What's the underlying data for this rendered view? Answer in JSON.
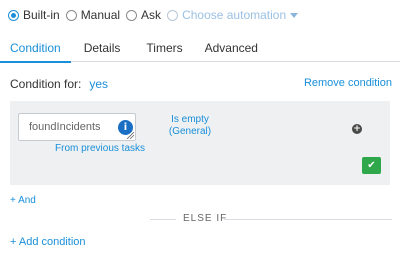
{
  "automation_mode": {
    "options": [
      {
        "label": "Built-in",
        "checked": true
      },
      {
        "label": "Manual",
        "checked": false
      },
      {
        "label": "Ask",
        "checked": false
      }
    ],
    "choose_automation": "Choose automation"
  },
  "tabs": [
    "Condition",
    "Details",
    "Timers",
    "Advanced"
  ],
  "active_tab": "Condition",
  "condition": {
    "label": "Condition for:",
    "value": "yes",
    "remove_label": "Remove condition",
    "field_value": "foundIncidents",
    "info_icon": "info-icon",
    "source_label": "From previous tasks",
    "operator_line1": "Is empty",
    "operator_line2": "(General)",
    "plus_icon": "plus-circle-icon",
    "check_icon": "check-icon"
  },
  "and_label": "+ And",
  "else_if_label": "ELSE IF",
  "add_condition_label": "+ Add condition",
  "colors": {
    "accent": "#1a8fd9",
    "panel_bg": "#eef0f2",
    "confirm_green": "#2ea84b",
    "info_blue": "#1a6fc4"
  }
}
